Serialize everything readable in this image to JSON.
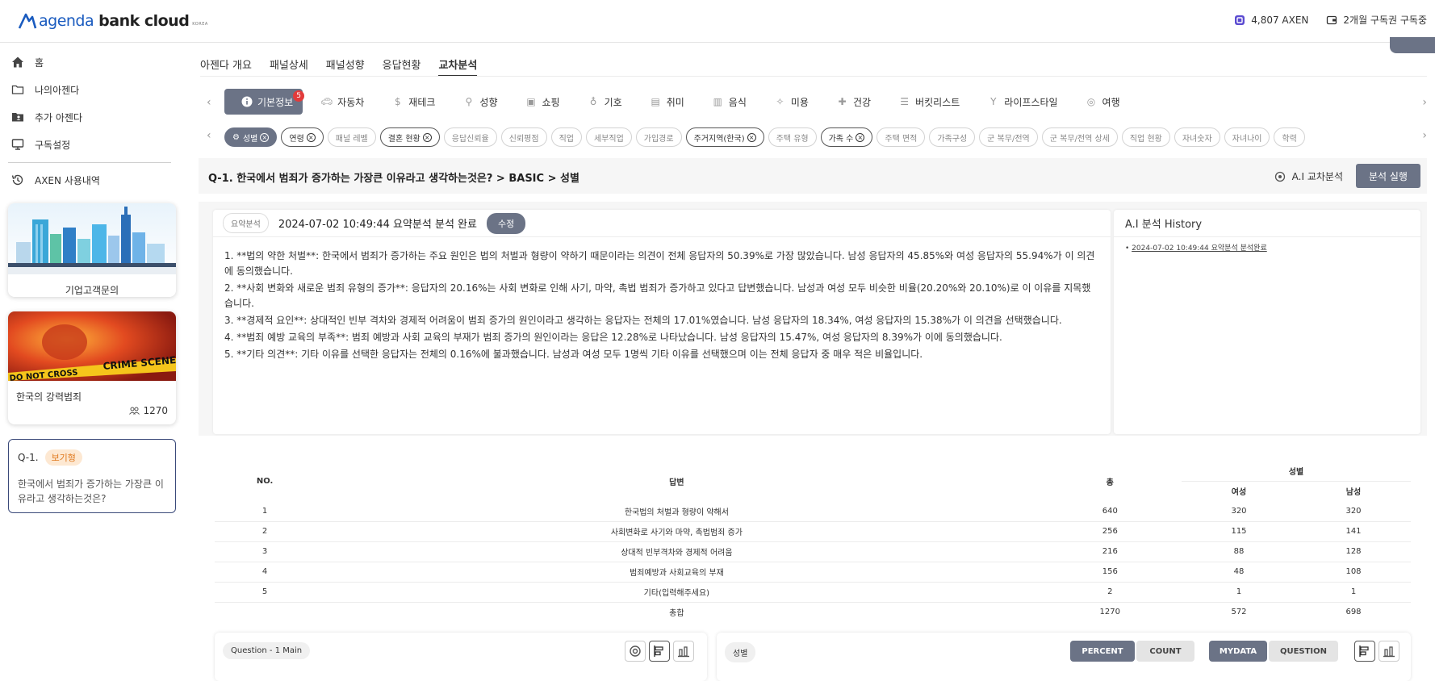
{
  "header": {
    "logo_agenda": "agenda",
    "logo_bank": "bank cloud",
    "logo_korea": "KOREA",
    "axen_balance": "4,807 AXEN",
    "subscription": "2개월 구독권 구독중"
  },
  "sidebar": {
    "items": [
      {
        "label": "홈",
        "icon": "home-icon"
      },
      {
        "label": "나의아젠다",
        "icon": "folder-icon"
      },
      {
        "label": "추가 아젠다",
        "icon": "folder-user-icon"
      },
      {
        "label": "구독설정",
        "icon": "monitor-icon"
      }
    ],
    "usage": {
      "label": "AXEN 사용내역",
      "icon": "history-icon"
    },
    "card1": {
      "caption": "기업고객문의"
    },
    "card2": {
      "title": "한국의 강력범죄",
      "count": "1270",
      "banner_text": "CRIME SCENE",
      "banner_text2": "DO NOT CROSS"
    },
    "question_card": {
      "num": "Q-1.",
      "tag": "보기형",
      "text": "한국에서 범죄가 증가하는 가장큰 이유라고 생각하는것은?"
    }
  },
  "top_tabs": [
    "아젠다 개요",
    "패널상세",
    "패널성향",
    "응답현황",
    "교차분석"
  ],
  "categories": [
    {
      "label": "기본정보",
      "badge": "5"
    },
    {
      "label": "자동차"
    },
    {
      "label": "재테크"
    },
    {
      "label": "성향"
    },
    {
      "label": "쇼핑"
    },
    {
      "label": "기호"
    },
    {
      "label": "취미"
    },
    {
      "label": "음식"
    },
    {
      "label": "미용"
    },
    {
      "label": "건강"
    },
    {
      "label": "버킷리스트"
    },
    {
      "label": "라이프스타일"
    },
    {
      "label": "여행"
    }
  ],
  "chips": [
    "성별",
    "연령",
    "패널 레벨",
    "결혼 현황",
    "응답신뢰율",
    "신뢰평점",
    "직업",
    "세부직업",
    "가입경로",
    "주거지역(한국)",
    "주택 유형",
    "가족 수",
    "주택 면적",
    "가족구성",
    "군 복무/전역",
    "군 복무/전역 상세",
    "직업 현황",
    "자녀숫자",
    "자녀나이",
    "학력"
  ],
  "question_title": "Q-1. 한국에서 범죄가 증가하는 가장큰 이유라고 생각하는것은? > BASIC > 성별",
  "ai_cross_label": "A.I 교차분석",
  "run_button": "분석 실행",
  "summary": {
    "tag": "요약분석",
    "date_text": "2024-07-02 10:49:44 요약분석 분석 완료",
    "edit_button": "수정",
    "paragraphs": [
      "1. **법의 약한 처벌**: 한국에서 범죄가 증가하는 주요 원인은 법의 처벌과 형량이 약하기 때문이라는 의견이 전체 응답자의 50.39%로 가장 많았습니다. 남성 응답자의 45.85%와 여성 응답자의 55.94%가 이 의견에 동의했습니다.",
      "2. **사회 변화와 새로운 범죄 유형의 증가**: 응답자의 20.16%는 사회 변화로 인해 사기, 마약, 촉법 범죄가 증가하고 있다고 답변했습니다. 남성과 여성 모두 비슷한 비율(20.20%와 20.10%)로 이 이유를 지목했습니다.",
      "3. **경제적 요인**: 상대적인 빈부 격차와 경제적 어려움이 범죄 증가의 원인이라고 생각하는 응답자는 전체의 17.01%였습니다. 남성 응답자의 18.34%, 여성 응답자의 15.38%가 이 의견을 선택했습니다.",
      "4. **범죄 예방 교육의 부족**: 범죄 예방과 사회 교육의 부재가 범죄 증가의 원인이라는 응답은 12.28%로 나타났습니다. 남성 응답자의 15.47%, 여성 응답자의 8.39%가 이에 동의했습니다.",
      "5. **기타 의견**: 기타 이유를 선택한 응답자는 전체의 0.16%에 불과했습니다. 남성과 여성 모두 1명씩 기타 이유를 선택했으며 이는 전체 응답자 중 매우 적은 비율입니다."
    ]
  },
  "history": {
    "title": "A.I 분석 History",
    "items": [
      "2024-07-02 10:49:44 요약분석 분석완료"
    ]
  },
  "table": {
    "headers": {
      "no": "NO.",
      "answer": "답변",
      "total": "총",
      "group": "성별",
      "female": "여성",
      "male": "남성"
    },
    "rows": [
      {
        "no": "1",
        "answer": "한국법의 처벌과 형량이 약해서",
        "total": "640",
        "female": "320",
        "male": "320"
      },
      {
        "no": "2",
        "answer": "사회변화로 사기와 마약, 촉법범죄 증가",
        "total": "256",
        "female": "115",
        "male": "141"
      },
      {
        "no": "3",
        "answer": "상대적 빈부격차와 경제적 어려움",
        "total": "216",
        "female": "88",
        "male": "128"
      },
      {
        "no": "4",
        "answer": "범죄예방과 사회교육의 부재",
        "total": "156",
        "female": "48",
        "male": "108"
      },
      {
        "no": "5",
        "answer": "기타(입력해주세요)",
        "total": "2",
        "female": "1",
        "male": "1"
      }
    ],
    "total_row": {
      "no": "",
      "answer": "총합",
      "total": "1270",
      "female": "572",
      "male": "698"
    }
  },
  "bottom": {
    "left_label": "Question - 1 Main",
    "right_label": "성별",
    "percent": "PERCENT",
    "count": "COUNT",
    "mydata": "MYDATA",
    "question": "QUESTION"
  }
}
